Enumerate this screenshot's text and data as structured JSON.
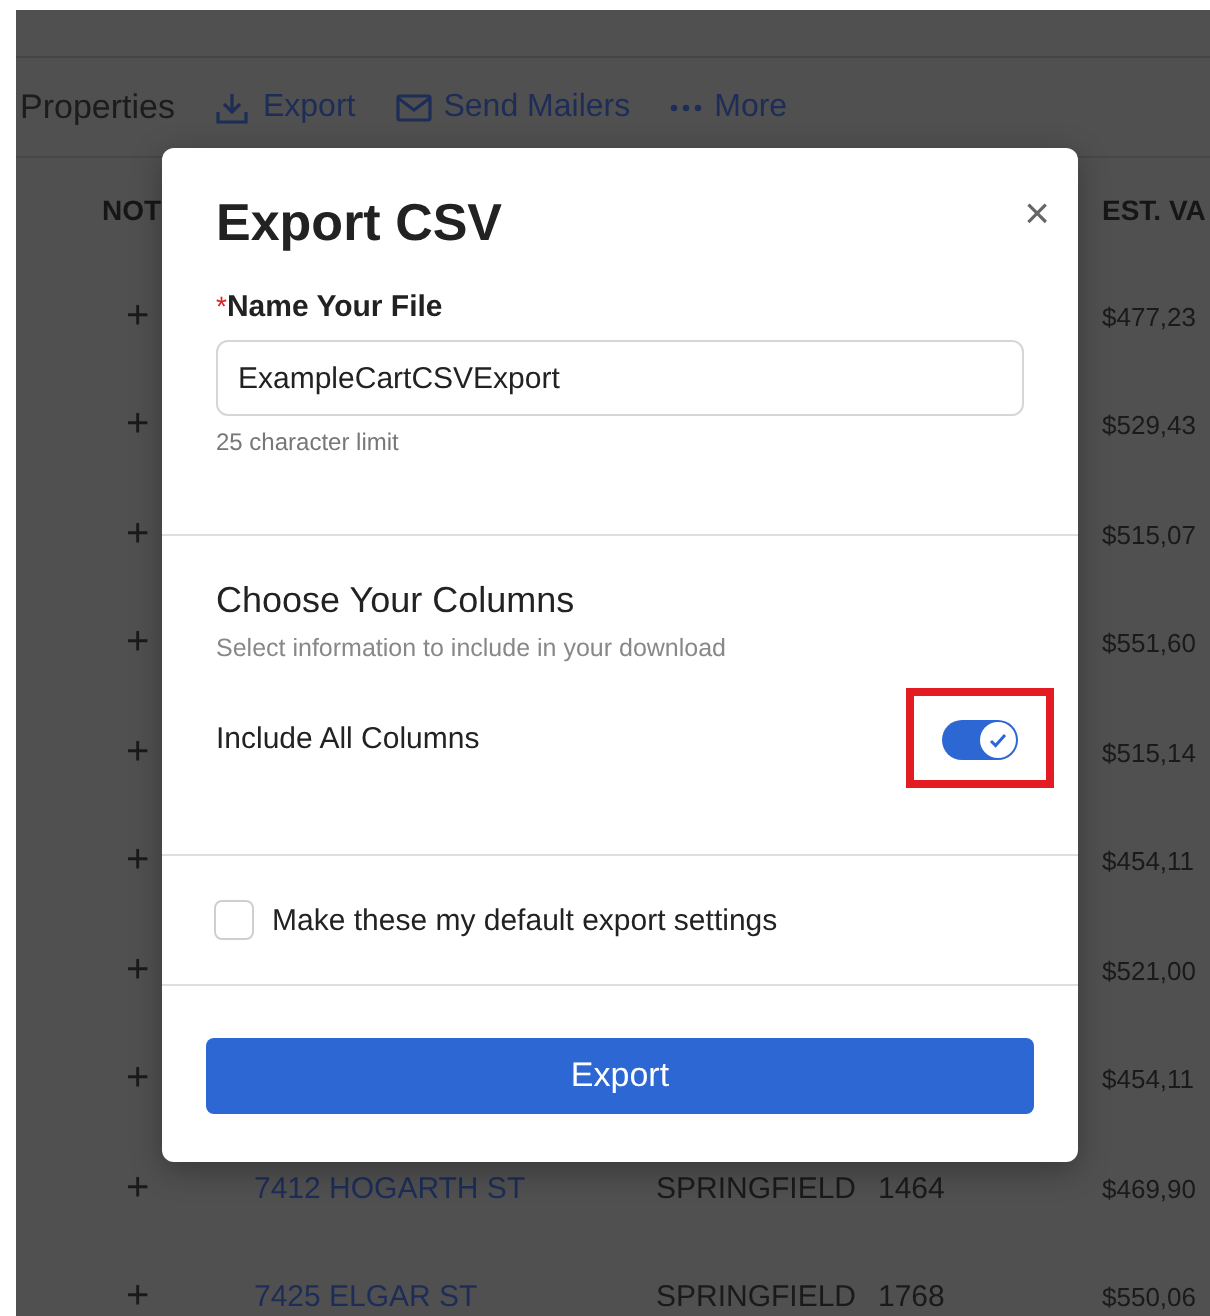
{
  "toolbar": {
    "title": "Properties",
    "actions": [
      {
        "kind": "download",
        "label": "Export"
      },
      {
        "kind": "mail",
        "label": "Send Mailers"
      },
      {
        "kind": "dots",
        "label": "More"
      }
    ]
  },
  "table": {
    "columns": [
      {
        "label": "NOT"
      },
      {
        "label": "EST. VA"
      }
    ],
    "rows": [
      {
        "expand": "+",
        "est_value": "$477,23"
      },
      {
        "expand": "+",
        "est_value": "$529,43"
      },
      {
        "expand": "+",
        "est_value": "$515,07"
      },
      {
        "expand": "+",
        "est_value": "$551,60"
      },
      {
        "expand": "+",
        "est_value": "$515,14"
      },
      {
        "expand": "+",
        "est_value": "$454,11"
      },
      {
        "expand": "+",
        "est_value": "$521,00"
      },
      {
        "expand": "+",
        "est_value": "$454,11"
      },
      {
        "expand": "+",
        "address": "7412 HOGARTH ST",
        "city": "SPRINGFIELD",
        "number": "1464",
        "est_value": "$469,90"
      },
      {
        "expand": "+",
        "address": "7425 ELGAR ST",
        "city": "SPRINGFIELD",
        "number": "1768",
        "est_value": "$550,06"
      }
    ]
  },
  "dialog": {
    "title": "Export CSV",
    "close": "×",
    "file_field": {
      "required_mark": "*",
      "label": "Name Your File",
      "value": "ExampleCartCSVExport",
      "hint": "25 character limit"
    },
    "columns_section": {
      "title": "Choose Your Columns",
      "subtitle": "Select information to include in your download",
      "toggle": {
        "label": "Include All Columns",
        "on": true,
        "highlighted": true
      }
    },
    "default_checkbox": {
      "label": "Make these my default export settings",
      "checked": false
    },
    "button": "Export"
  }
}
